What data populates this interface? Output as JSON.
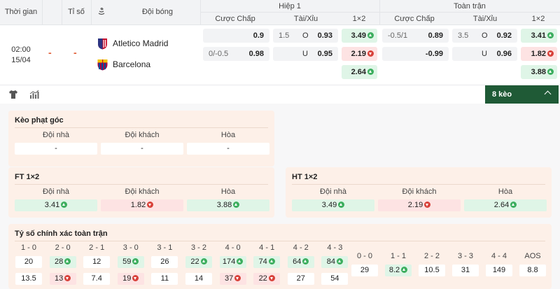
{
  "header": {
    "col_time": "Thời gian",
    "col_score": "Tỉ số",
    "col_team": "Đội bóng",
    "half1": "Hiệp 1",
    "full": "Toàn trận",
    "sub": [
      "Cược Chấp",
      "Tài/Xỉu",
      "1×2",
      "Cược Chấp",
      "Tài/Xỉu",
      "1×2"
    ]
  },
  "match": {
    "time": "02:00",
    "date": "15/04",
    "score_home": "-",
    "score_away": "-",
    "home": "Atletico Madrid",
    "away": "Barcelona",
    "h1": {
      "hc": [
        {
          "line": "",
          "odd": "0.9"
        },
        {
          "line": "0/-0.5",
          "odd": "0.98"
        }
      ],
      "ou": [
        {
          "line": "1.5",
          "side": "O",
          "odd": "0.93"
        },
        {
          "line": "",
          "side": "U",
          "odd": "0.95"
        }
      ],
      "x12": [
        "3.49",
        "2.19",
        "2.64"
      ]
    },
    "ft": {
      "hc": [
        {
          "line": "-0.5/1",
          "odd": "0.89"
        },
        {
          "line": "",
          "odd": "-0.99"
        }
      ],
      "ou": [
        {
          "line": "3.5",
          "side": "O",
          "odd": "0.92"
        },
        {
          "line": "",
          "side": "U",
          "odd": "0.96"
        }
      ],
      "x12": [
        "3.41",
        "1.82",
        "3.88"
      ]
    }
  },
  "toolbar": {
    "keo_label": "8 kèo"
  },
  "corner": {
    "title": "Kèo phạt góc",
    "labels": [
      "Đội nhà",
      "Đội khách",
      "Hòa"
    ],
    "values": [
      "-",
      "-",
      "-"
    ]
  },
  "ft12": {
    "title": "FT 1×2",
    "labels": [
      "Đội nhà",
      "Đội khách",
      "Hòa"
    ],
    "values": [
      "3.41",
      "1.82",
      "3.88"
    ]
  },
  "ht12": {
    "title": "HT 1×2",
    "labels": [
      "Đội nhà",
      "Đội khách",
      "Hòa"
    ],
    "values": [
      "3.49",
      "2.19",
      "2.64"
    ]
  },
  "exact": {
    "title": "Tỷ số chính xác toàn trận",
    "home_labels": [
      "1 - 0",
      "2 - 0",
      "2 - 1",
      "3 - 0",
      "3 - 1",
      "3 - 2",
      "4 - 0",
      "4 - 1",
      "4 - 2",
      "4 - 3"
    ],
    "home_row1": [
      "20",
      "28",
      "12",
      "59",
      "26",
      "22",
      "174",
      "74",
      "64",
      "84"
    ],
    "home_row2": [
      "13.5",
      "13",
      "7.4",
      "19",
      "11",
      "14",
      "37",
      "22",
      "27",
      "54"
    ],
    "draw_labels": [
      "0 - 0",
      "1 - 1",
      "2 - 2",
      "3 - 3",
      "4 - 4",
      "AOS"
    ],
    "draw_values": [
      "29",
      "8.2",
      "10.5",
      "31",
      "149",
      "8.8"
    ]
  },
  "colors": {
    "up": "#dff5e7",
    "down": "#fde3e3",
    "accent": "#1f5a36",
    "card": "#fdf0e8"
  },
  "icons": [
    "shirt-icon",
    "stats-chart-icon",
    "chevron-up-icon",
    "arrow-up-icon",
    "arrow-down-icon",
    "stadium-icon"
  ]
}
